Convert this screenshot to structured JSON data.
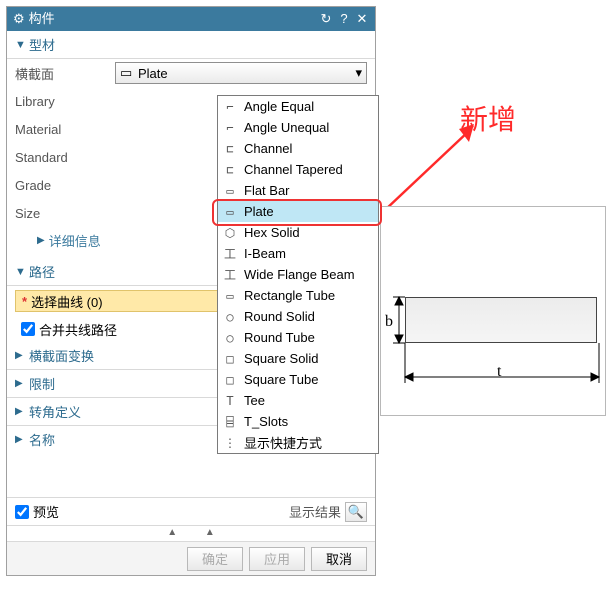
{
  "title": "构件",
  "sections": {
    "profile": "型材",
    "path": "路径",
    "xsectTransform": "横截面变换",
    "limit": "限制",
    "cornerDef": "转角定义",
    "name": "名称"
  },
  "labels": {
    "crossSection": "横截面",
    "library": "Library",
    "material": "Material",
    "standard": "Standard",
    "grade": "Grade",
    "size": "Size",
    "details": "详细信息",
    "selectCurve": "选择曲线 (0)",
    "mergeColinear": "合并共线路径",
    "preview": "预览",
    "showResult": "显示结果"
  },
  "dropdown": {
    "selected": "Plate",
    "items": [
      "Angle Equal",
      "Angle Unequal",
      "Channel",
      "Channel Tapered",
      "Flat Bar",
      "Plate",
      "Hex Solid",
      "I-Beam",
      "Wide Flange Beam",
      "Rectangle Tube",
      "Round Solid",
      "Round Tube",
      "Square Solid",
      "Square Tube",
      "Tee",
      "T_Slots",
      "显示快捷方式"
    ],
    "icons": [
      "⌐",
      "⌐",
      "⊏",
      "⊏",
      "▭",
      "▭",
      "⬡",
      "工",
      "工",
      "▭",
      "○",
      "○",
      "□",
      "□",
      "T",
      "⌸",
      "⋮"
    ]
  },
  "buttons": {
    "ok": "确定",
    "apply": "应用",
    "cancel": "取消"
  },
  "callout": "新增",
  "previewDims": {
    "b": "b",
    "t": "t"
  }
}
